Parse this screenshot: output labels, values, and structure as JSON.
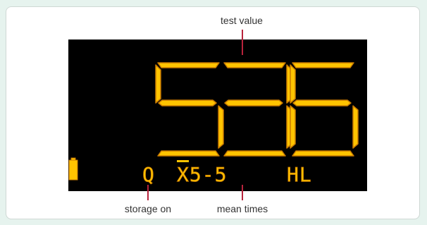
{
  "display": {
    "main_value": "536",
    "storage_indicator": "Q",
    "mean_times": "X5-5",
    "mode": "HL",
    "battery_icon": "battery-icon"
  },
  "callouts": {
    "test_value": "test value",
    "storage_on": "storage on",
    "mean_times": "mean times"
  },
  "colors": {
    "lcd_background": "#000000",
    "segment": "#ffc400",
    "segment_outline": "#c97a00",
    "leader_line": "#b8233c",
    "page_background": "#e6f3ee"
  }
}
